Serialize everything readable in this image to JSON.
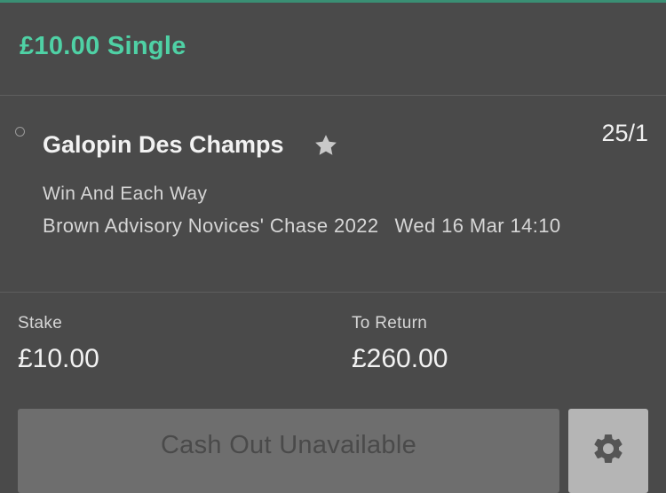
{
  "bet": {
    "title": "£10.00 Single"
  },
  "selection": {
    "runner_name": "Galopin Des Champs",
    "odds": "25/1",
    "market": "Win And Each Way",
    "event_name": "Brown Advisory Novices' Chase 2022",
    "event_date": "Wed 16 Mar",
    "event_time": "14:10",
    "favourite_icon": "star-icon",
    "status_icon": "circle-outline-icon"
  },
  "stake": {
    "label": "Stake",
    "value": "£10.00"
  },
  "to_return": {
    "label": "To Return",
    "value": "£260.00"
  },
  "actions": {
    "cashout_label": "Cash Out Unavailable",
    "settings_icon": "gear-icon"
  },
  "colors": {
    "background": "#4a4a4a",
    "accent": "#4fd1a5",
    "divider": "#5e5e5e",
    "cashout_bg": "#6e6e6e",
    "settings_bg": "#b5b5b5"
  }
}
